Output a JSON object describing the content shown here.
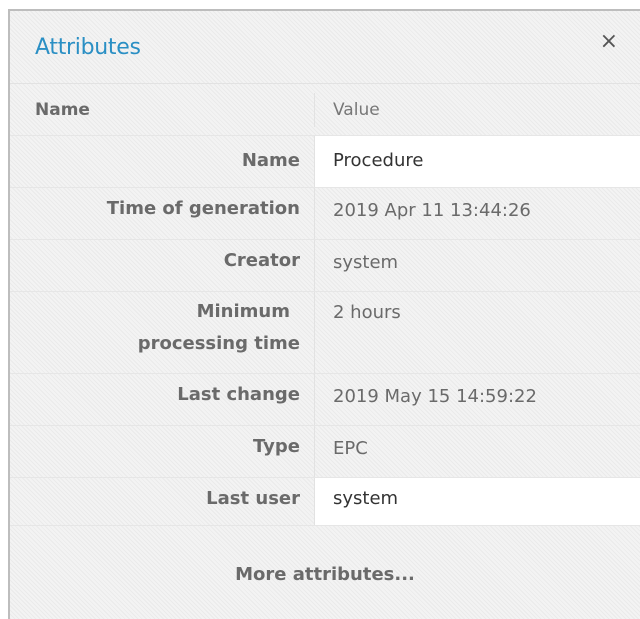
{
  "panel": {
    "title": "Attributes",
    "close_label": "×"
  },
  "table": {
    "header": {
      "name": "Name",
      "value": "Value"
    },
    "rows": [
      {
        "name": "Name",
        "value": "Procedure",
        "white": true
      },
      {
        "name": "Time of generation",
        "value": "2019 Apr 11 13:44:26",
        "white": false
      },
      {
        "name": "Creator",
        "value": "system",
        "white": false
      },
      {
        "name_lines": [
          "Minimum",
          "processing time"
        ],
        "value": "2 hours",
        "white": false
      },
      {
        "name": "Last change",
        "value": "2019 May 15 14:59:22",
        "white": false
      },
      {
        "name": "Type",
        "value": "EPC",
        "white": false
      },
      {
        "name": "Last user",
        "value": "system",
        "white": true
      }
    ]
  },
  "more_attributes_label": "More attributes..."
}
